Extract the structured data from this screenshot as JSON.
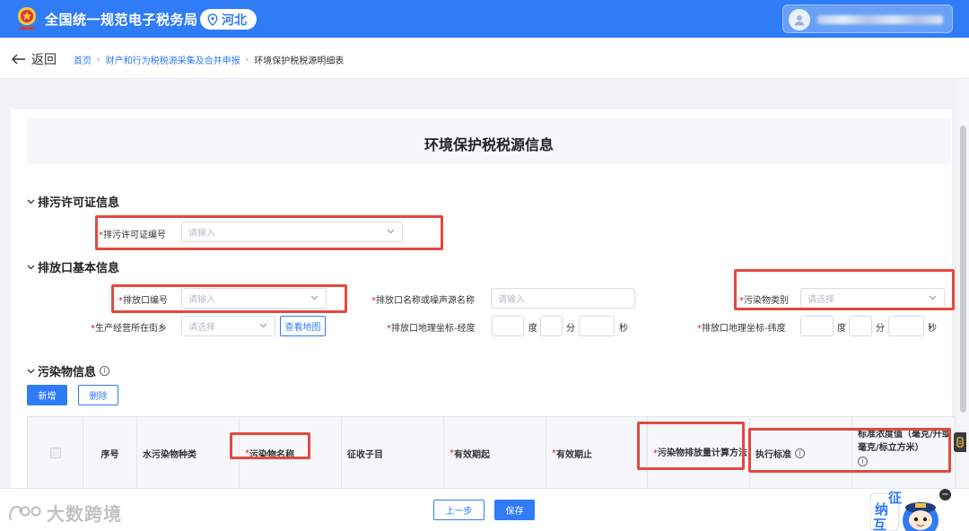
{
  "header": {
    "site_title": "全国统一规范电子税务局",
    "region": "河北",
    "colors": {
      "primary": "#2f7cf6",
      "required": "#e02020",
      "highlight": "#e5483f"
    }
  },
  "nav": {
    "back_label": "返回",
    "breadcrumbs": [
      "首页",
      "财产和行为税税源采集及合并申报",
      "环境保护税税源明细表"
    ]
  },
  "form": {
    "title": "环境保护税税源信息",
    "permit_section": {
      "heading": "排污许可证信息",
      "permit_no_label": "排污许可证编号",
      "permit_no_placeholder": "请输入"
    },
    "outlet_section": {
      "heading": "排放口基本信息",
      "outlet_no_label": "排放口编号",
      "outlet_no_placeholder": "请输入",
      "outlet_name_label": "排放口名称或噪声源名称",
      "outlet_name_placeholder": "请输入",
      "pollutant_cat_label": "污染物类别",
      "pollutant_cat_placeholder": "请选择",
      "street_label": "生产经营所在街乡",
      "street_placeholder": "请选择",
      "view_map": "查看地图",
      "longitude_label": "排放口地理坐标-经度",
      "latitude_label": "排放口地理坐标-纬度",
      "unit_deg": "度",
      "unit_min": "分",
      "unit_sec": "秒"
    },
    "pollutant_section": {
      "heading": "污染物信息",
      "add_button": "新增",
      "delete_button": "删除",
      "columns": [
        "序号",
        "水污染物种类",
        "污染物名称",
        "征收子目",
        "有效期起",
        "有效期止",
        "污染物排放量计算方法",
        "执行标准",
        "标准浓度值（毫克/升或毫克/标立方米）"
      ]
    }
  },
  "footer": {
    "prev_button": "上一步",
    "save_button": "保存",
    "watermark": "大数跨境",
    "mascot_text": [
      "征",
      "纳",
      "互"
    ]
  }
}
